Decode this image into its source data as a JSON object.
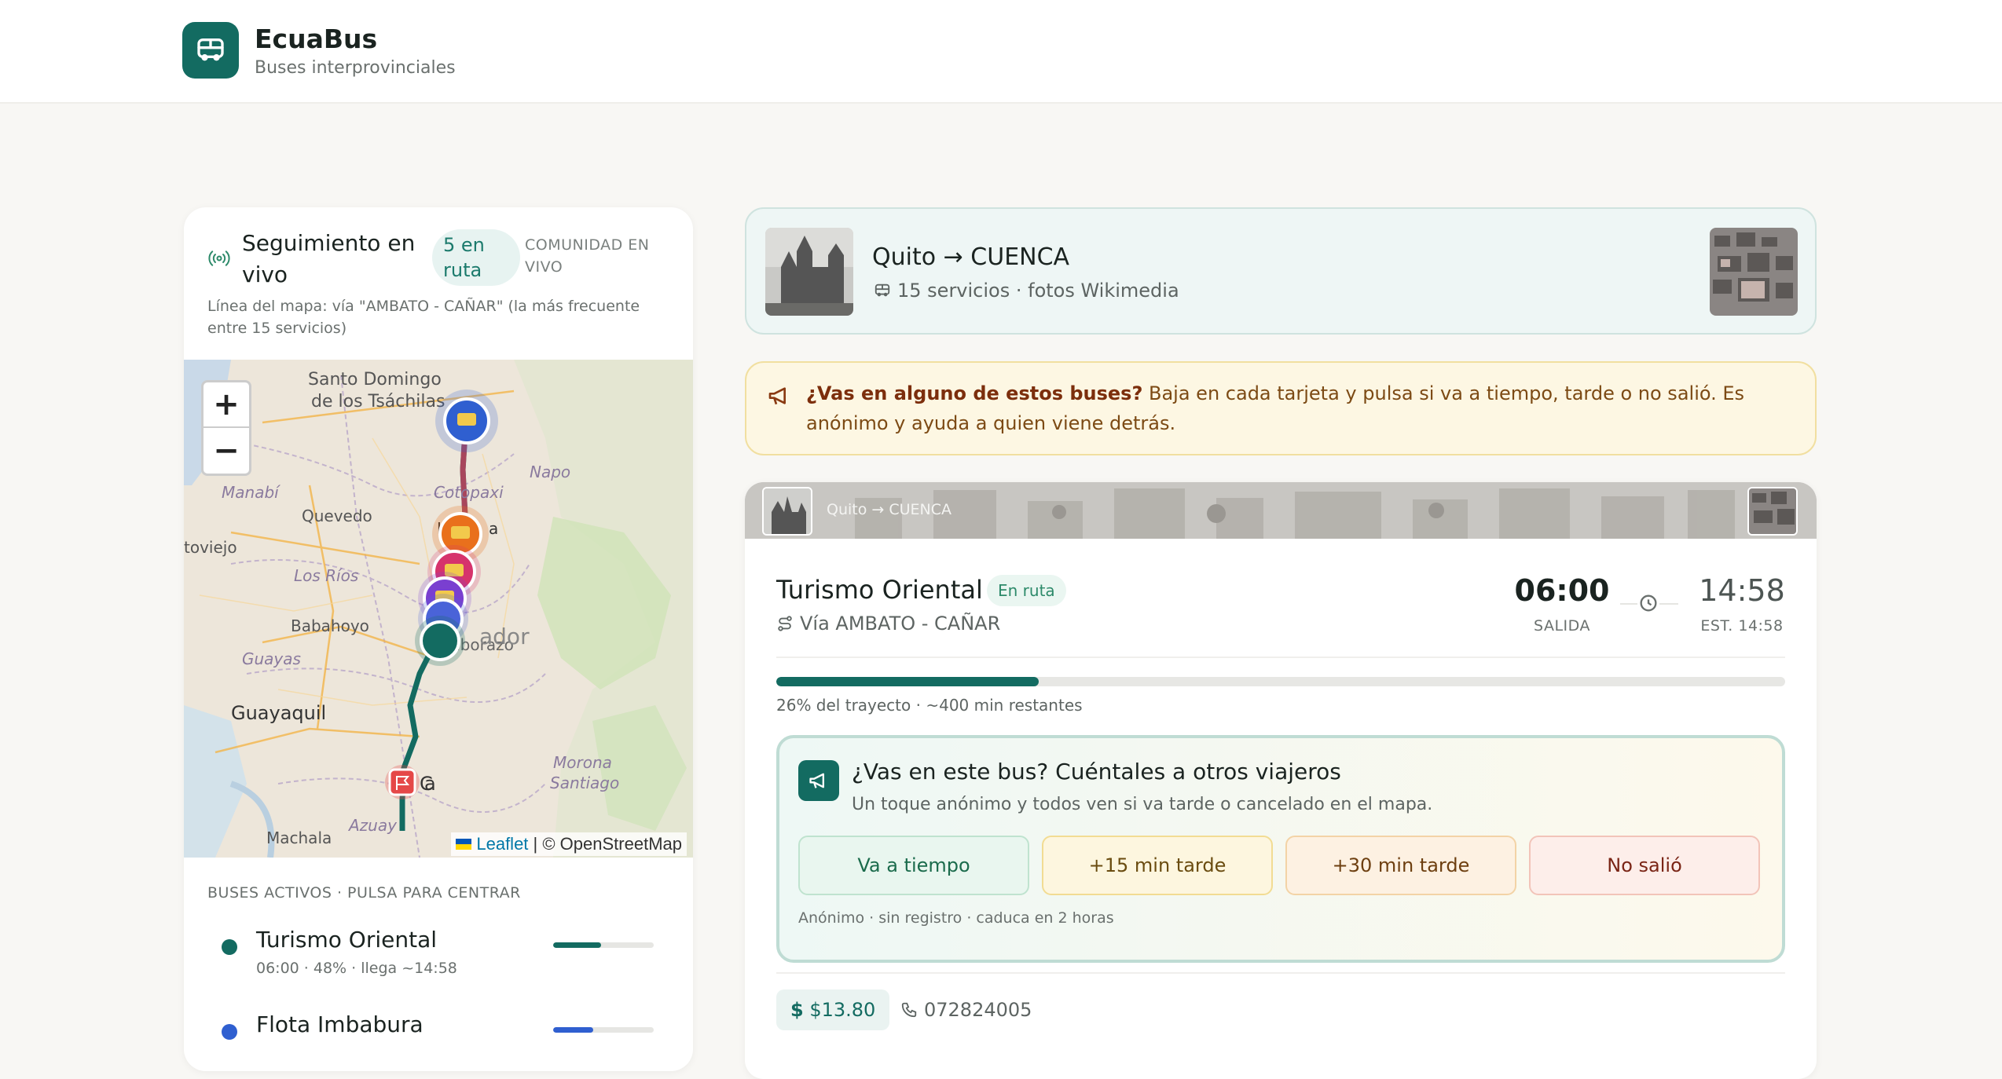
{
  "header": {
    "brand": "EcuaBus",
    "subtitle": "Buses interprovinciales"
  },
  "live": {
    "title": "Seguimiento en vivo",
    "badge": "5 en ruta",
    "community": "COMUNIDAD EN VIVO",
    "map_note": "Línea del mapa: vía \"AMBATO - CAÑAR\" (la más frecuente entre 15 servicios)",
    "active_label": "BUSES ACTIVOS · PULSA PARA CENTRAR"
  },
  "map": {
    "zoom_in": "+",
    "zoom_out": "−",
    "attribution_leaflet": "Leaflet",
    "attribution_sep": " | © OpenStreetMap",
    "labels": {
      "santo_domingo": "Santo Domingo",
      "tsachilas": "de los Tsáchilas",
      "manabi": "Manabí",
      "quevedo": "Quevedo",
      "cotopaxi": "Cotopaxi",
      "napo": "Napo",
      "portoviejo": "toviejo",
      "los_rios": "Los Ríos",
      "babahoyo": "Babahoyo",
      "guayas": "Guayas",
      "guayaquil": "Guayaquil",
      "chimborazo": "Chimborazo",
      "ecuador": "ador",
      "morona": "Morona",
      "santiago": "Santiago",
      "azuay": "Azuay",
      "machala": "Machala",
      "cuenca_a": "C",
      "cuenca_b": "a",
      "latacunga_a": "La",
      "latacunga_b": "a"
    }
  },
  "active_buses": [
    {
      "name": "Turismo Oriental",
      "meta": "06:00 · 48% · llega ~14:58",
      "progress": 0.48,
      "color": "#136b61"
    },
    {
      "name": "Flota Imbabura",
      "meta": "",
      "progress": 0.4,
      "color": "#2f5fd0"
    }
  ],
  "route": {
    "title": "Quito → CUENCA",
    "subtitle": "15 servicios · fotos Wikimedia"
  },
  "notice": {
    "bold": "¿Vas en alguno de estos buses?",
    "text": " Baja en cada tarjeta y pulsa si va a tiempo, tarde o no salió. Es anónimo y ayuda a quien viene detrás."
  },
  "service": {
    "banner": "Quito → CUENCA",
    "operator": "Turismo Oriental",
    "status": "En ruta",
    "via": "Vía AMBATO - CAÑAR",
    "departure": "06:00",
    "departure_label": "SALIDA",
    "arrival": "14:58",
    "arrival_label": "EST. 14:58",
    "progress": 0.26,
    "progress_text": "26% del trayecto · ~400 min restantes",
    "price": "$13.80",
    "phone": "072824005"
  },
  "report": {
    "title": "¿Vas en este bus? Cuéntales a otros viajeros",
    "subtitle": "Un toque anónimo y todos ven si va tarde o cancelado en el mapa.",
    "buttons": {
      "on_time": "Va a tiempo",
      "late15": "+15 min tarde",
      "late30": "+30 min tarde",
      "not_departed": "No salió"
    },
    "footer": "Anónimo · sin registro · caduca en 2 horas"
  },
  "colors": {
    "brand": "#136b61",
    "route_line": "#136b61",
    "route_line_north": "#a8465c"
  },
  "icons": {
    "logo": "bus-icon",
    "live": "broadcast-icon",
    "notice": "megaphone-icon",
    "via": "route-icon",
    "clock": "clock-icon",
    "phone": "phone-icon"
  }
}
